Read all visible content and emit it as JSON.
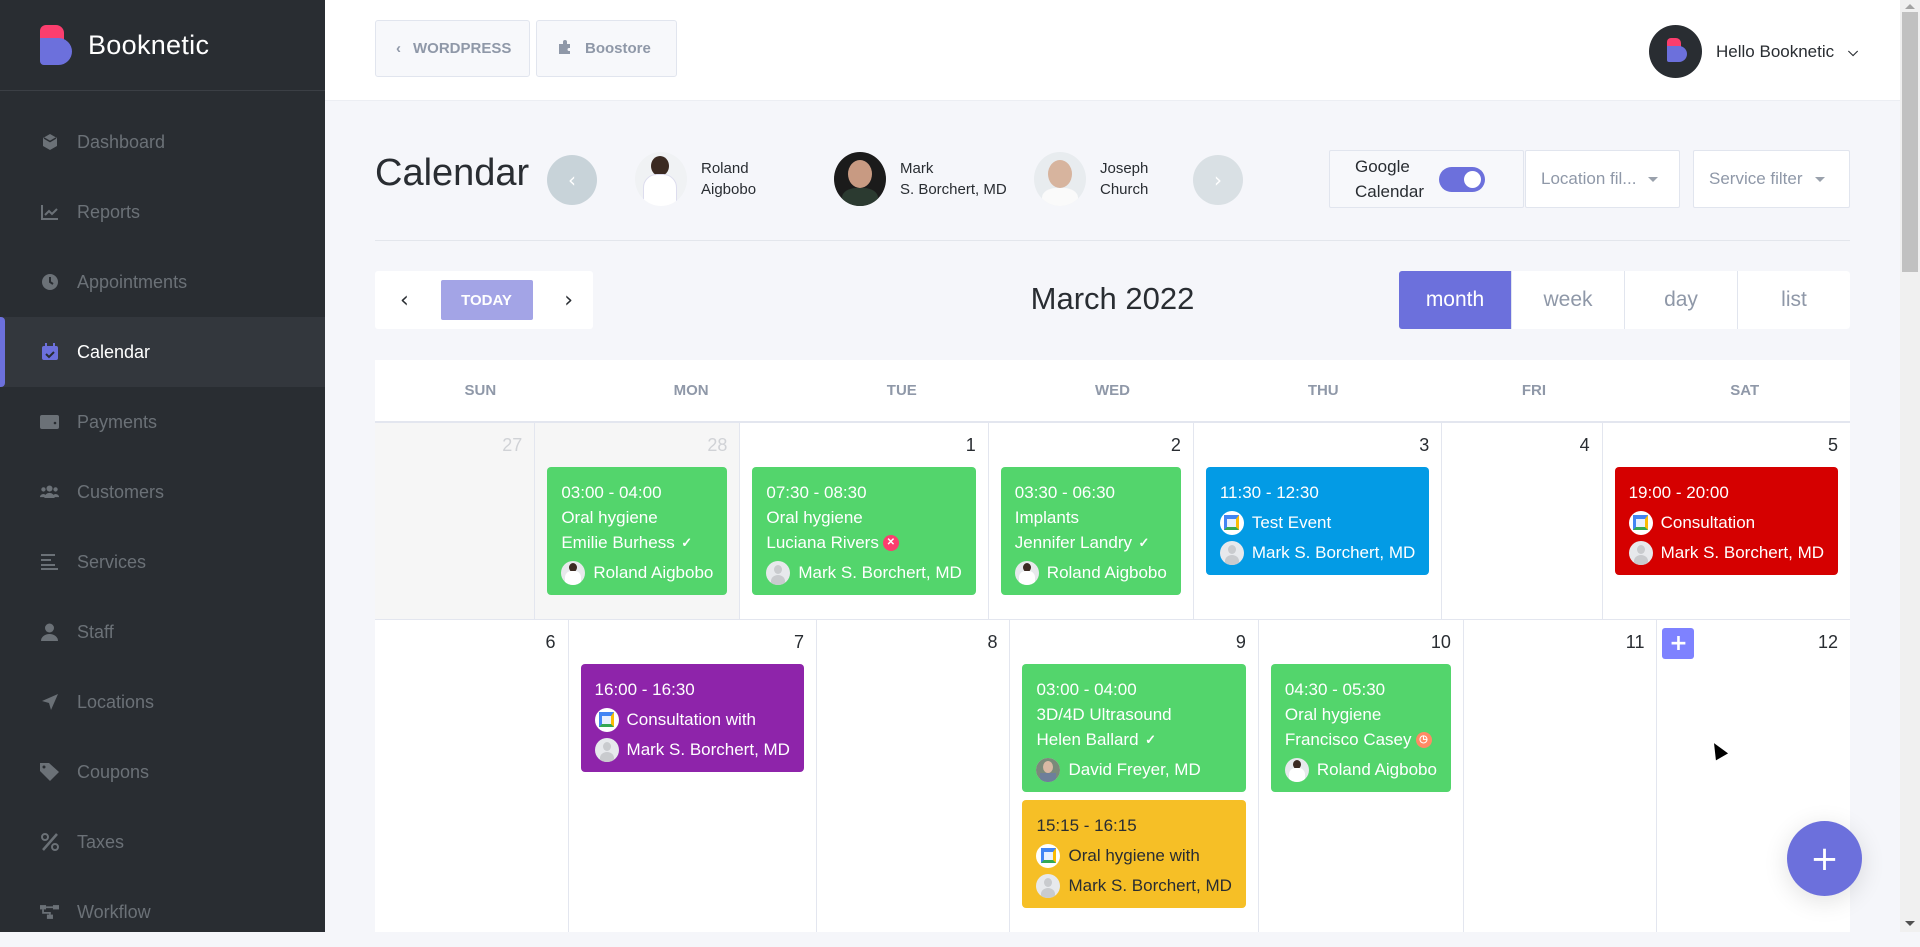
{
  "app": {
    "name": "Booknetic"
  },
  "sidebar": {
    "items": [
      {
        "label": "Dashboard",
        "icon": "cube-icon",
        "active": false
      },
      {
        "label": "Reports",
        "icon": "chart-line-icon",
        "active": false
      },
      {
        "label": "Appointments",
        "icon": "clock-icon",
        "active": false
      },
      {
        "label": "Calendar",
        "icon": "calendar-check-icon",
        "active": true
      },
      {
        "label": "Payments",
        "icon": "wallet-icon",
        "active": false
      },
      {
        "label": "Customers",
        "icon": "users-icon",
        "active": false
      },
      {
        "label": "Services",
        "icon": "list-icon",
        "active": false
      },
      {
        "label": "Staff",
        "icon": "user-icon",
        "active": false
      },
      {
        "label": "Locations",
        "icon": "location-arrow-icon",
        "active": false
      },
      {
        "label": "Coupons",
        "icon": "tag-icon",
        "active": false
      },
      {
        "label": "Taxes",
        "icon": "percent-icon",
        "active": false
      },
      {
        "label": "Workflow",
        "icon": "workflow-icon",
        "active": false
      }
    ]
  },
  "topbar": {
    "wordpress_label": "WORDPRESS",
    "boostore_label": "Boostore",
    "user_greeting": "Hello Booknetic"
  },
  "header": {
    "title": "Calendar",
    "staff": [
      {
        "first": "Roland",
        "second": "Aigbobo"
      },
      {
        "first": "Mark",
        "second": "S. Borchert, MD"
      },
      {
        "first": "Joseph",
        "second": "Church"
      }
    ],
    "google_calendar_line1": "Google",
    "google_calendar_line2": "Calendar",
    "google_calendar_enabled": true,
    "location_filter": "Location fil...",
    "service_filter": "Service filter"
  },
  "toolbar": {
    "today_label": "TODAY",
    "month_title": "March 2022",
    "views": [
      {
        "label": "month",
        "active": true
      },
      {
        "label": "week",
        "active": false
      },
      {
        "label": "day",
        "active": false
      },
      {
        "label": "list",
        "active": false
      }
    ]
  },
  "calendar": {
    "days_of_week": [
      "SUN",
      "MON",
      "TUE",
      "WED",
      "THU",
      "FRI",
      "SAT"
    ],
    "weeks": [
      [
        {
          "num": "27",
          "other": true,
          "events": []
        },
        {
          "num": "28",
          "other": true,
          "events": [
            {
              "time": "03:00 - 04:00",
              "service": "Oral hygiene",
              "customer": "Emilie Burhess",
              "status": "approved",
              "staff": "Roland Aigbobo",
              "color": "#53d56c",
              "google": false
            }
          ]
        },
        {
          "num": "1",
          "other": false,
          "events": [
            {
              "time": "07:30 - 08:30",
              "service": "Oral hygiene",
              "customer": "Luciana Rivers",
              "status": "canceled",
              "staff": "Mark S. Borchert, MD",
              "color": "#53d56c",
              "google": false
            }
          ]
        },
        {
          "num": "2",
          "other": false,
          "events": [
            {
              "time": "03:30 - 06:30",
              "service": "Implants",
              "customer": "Jennifer Landry",
              "status": "approved",
              "staff": "Roland Aigbobo",
              "color": "#53d56c",
              "google": false
            }
          ]
        },
        {
          "num": "3",
          "other": false,
          "events": [
            {
              "time": "11:30 - 12:30",
              "service": "Test Event",
              "customer": "",
              "status": "",
              "staff": "Mark S. Borchert, MD",
              "color": "#039be5",
              "google": true
            }
          ]
        },
        {
          "num": "4",
          "other": false,
          "events": []
        },
        {
          "num": "5",
          "other": false,
          "events": [
            {
              "time": "19:00 - 20:00",
              "service": "Consultation",
              "customer": "",
              "status": "",
              "staff": "Mark S. Borchert, MD",
              "color": "#d50000",
              "google": true
            }
          ]
        }
      ],
      [
        {
          "num": "6",
          "other": false,
          "events": []
        },
        {
          "num": "7",
          "other": false,
          "events": [
            {
              "time": "16:00 - 16:30",
              "service": "Consultation with",
              "customer": "",
              "status": "",
              "staff": "Mark S. Borchert, MD",
              "color": "#8e24aa",
              "google": true
            }
          ]
        },
        {
          "num": "8",
          "other": false,
          "events": []
        },
        {
          "num": "9",
          "other": false,
          "events": [
            {
              "time": "03:00 - 04:00",
              "service": "3D/4D Ultrasound",
              "customer": "Helen Ballard",
              "status": "approved",
              "staff": "David Freyer, MD",
              "color": "#53d56c",
              "google": false
            },
            {
              "time": "15:15 - 16:15",
              "service": "Oral hygiene with",
              "customer": "",
              "status": "",
              "staff": "Mark S. Borchert, MD",
              "color": "#f6bf26",
              "google": true,
              "dark_text": true
            }
          ]
        },
        {
          "num": "10",
          "other": false,
          "events": [
            {
              "time": "04:30 - 05:30",
              "service": "Oral hygiene",
              "customer": "Francisco Casey",
              "status": "pending",
              "staff": "Roland Aigbobo",
              "color": "#53d56c",
              "google": false
            }
          ]
        },
        {
          "num": "11",
          "other": false,
          "events": []
        },
        {
          "num": "12",
          "other": false,
          "add_button": true,
          "events": []
        }
      ]
    ]
  },
  "fab": {
    "label": "+"
  },
  "status_colors": {
    "approved": "#ffffff",
    "canceled": "#fb3e6e",
    "pending": "#ff8a65"
  },
  "accent": "#6c70dc"
}
